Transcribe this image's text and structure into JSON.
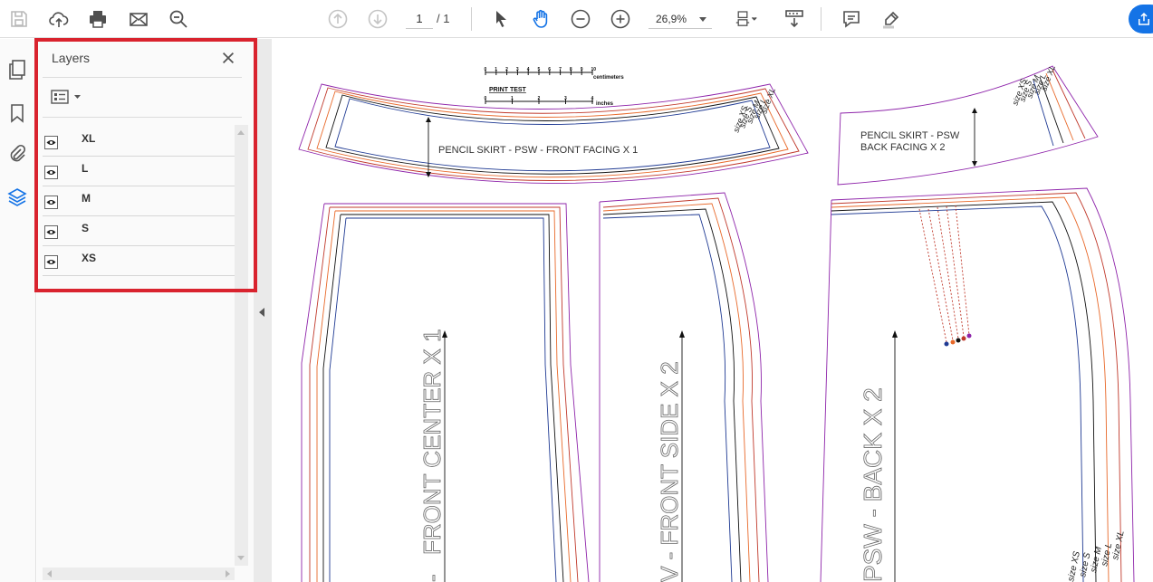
{
  "toolbar": {
    "page_current": "1",
    "page_total": "/ 1",
    "zoom": "26,9%"
  },
  "layers_panel": {
    "title": "Layers",
    "layers": [
      {
        "name": "XL"
      },
      {
        "name": "L"
      },
      {
        "name": "M"
      },
      {
        "name": "S"
      },
      {
        "name": "XS"
      }
    ]
  },
  "document": {
    "scale_top_label": "centimeters",
    "scale_ticks_cm": [
      "0",
      "1",
      "2",
      "3",
      "4",
      "5",
      "6",
      "7",
      "8",
      "9",
      "10"
    ],
    "print_test": "PRINT TEST",
    "scale_bottom_label": "inches",
    "scale_ticks_in": [
      "0",
      "1",
      "2",
      "3",
      "4"
    ],
    "front_facing": "PENCIL SKIRT - PSW -  FRONT FACING X 1",
    "back_facing_line1": "PENCIL SKIRT - PSW",
    "back_facing_line2": "BACK FACING X 2",
    "front_center": "FRONT CENTER X 1",
    "front_side": "V  -  FRONT SIDE X 2",
    "back": "PSW  -  BACK  X 2",
    "sizes": [
      "size XS",
      "size S",
      "size M",
      "size L",
      "size XL"
    ]
  },
  "colors": {
    "accent": "#1473e6",
    "highlight": "#d9232e",
    "size_xs": "#1f3a93",
    "size_s": "#111111",
    "size_m": "#e8692a",
    "size_l": "#c0392b",
    "size_xl": "#8e24aa"
  }
}
